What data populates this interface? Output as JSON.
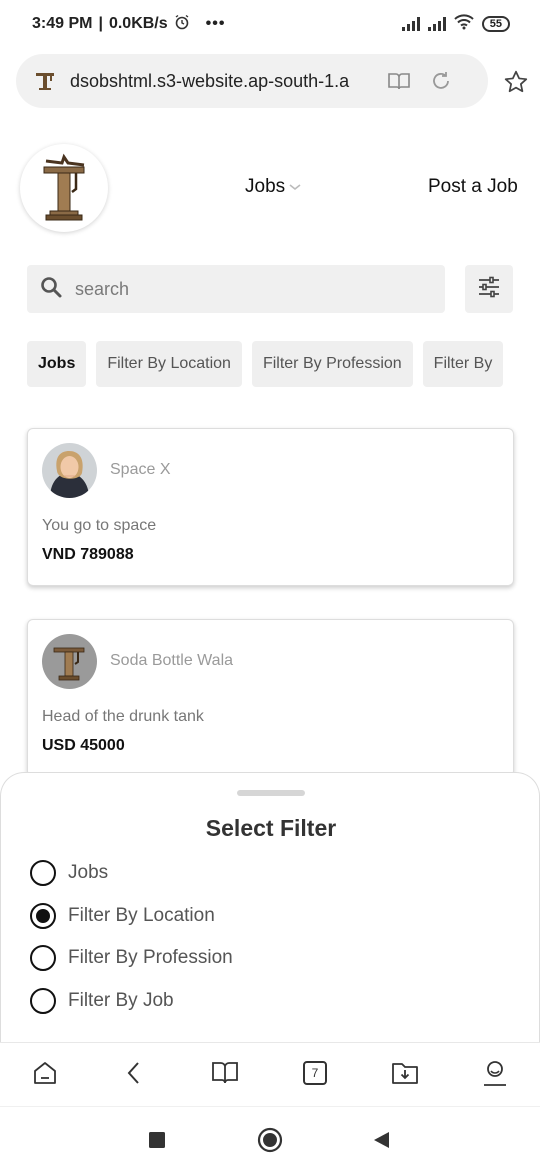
{
  "status_bar": {
    "time": "3:49 PM",
    "speed": "0.0KB/s",
    "dots": "•••",
    "battery": "55"
  },
  "address_bar": {
    "url": "dsobshtml.s3-website.ap-south-1.a"
  },
  "header": {
    "nav_jobs": "Jobs",
    "post_job": "Post a Job"
  },
  "search": {
    "placeholder": "search"
  },
  "chips": [
    {
      "label": "Jobs"
    },
    {
      "label": "Filter By Location"
    },
    {
      "label": "Filter By Profession"
    },
    {
      "label": "Filter By"
    }
  ],
  "jobs": [
    {
      "company": "Space X",
      "title": "You go to space",
      "salary": "VND 789088",
      "avatar": "person-photo"
    },
    {
      "company": "Soda Bottle Wala",
      "title": "Head of the drunk tank",
      "salary": "USD 45000",
      "avatar": "company-logo"
    }
  ],
  "filter_sheet": {
    "title": "Select Filter",
    "options": [
      {
        "label": "Jobs",
        "selected": false
      },
      {
        "label": "Filter By Location",
        "selected": true
      },
      {
        "label": "Filter By Profession",
        "selected": false
      },
      {
        "label": "Filter By Job",
        "selected": false
      }
    ]
  },
  "browser_nav": {
    "tab_count": "7"
  },
  "colors": {
    "surface": "#f0f0f0",
    "text": "#111111",
    "muted": "#9a9a9a",
    "logo_bronze": "#7a5a3a"
  }
}
